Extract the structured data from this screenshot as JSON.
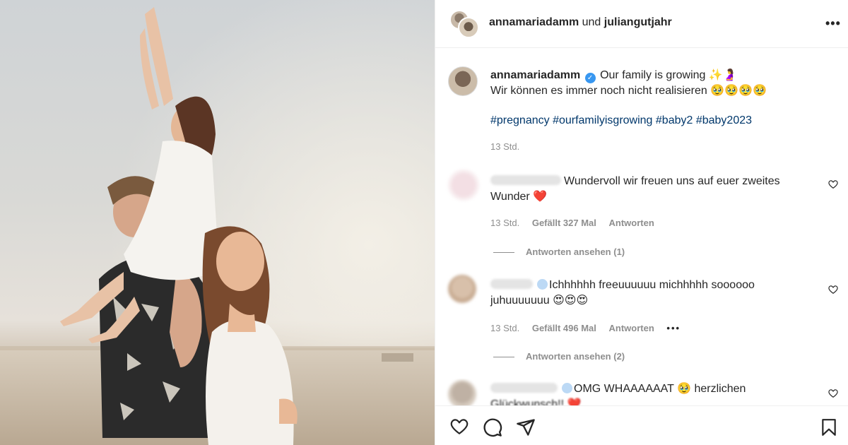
{
  "header": {
    "user1": "annamariadamm",
    "connector": "und",
    "user2": "juliangutjahr"
  },
  "caption": {
    "username": "annamariadamm",
    "verified_mark": "✓",
    "line1": "Our family is growing ✨🤰",
    "line2": "Wir können es immer noch nicht realisieren 🥹🥹🥹🥹",
    "hashtags": "#pregnancy #ourfamilyisgrowing #baby2 #baby2023",
    "time": "13 Std."
  },
  "comments": [
    {
      "text": "Wundervoll wir freuen uns auf euer zweites Wunder ❤️",
      "time": "13 Std.",
      "likes": "Gefällt 327 Mal",
      "reply": "Antworten",
      "view_replies": "Antworten ansehen (1)"
    },
    {
      "text": "Ichhhhhh freeuuuuuu michhhhh soooooo juhuuuuuuu 😍😍😍",
      "time": "13 Std.",
      "likes": "Gefällt 496 Mal",
      "reply": "Antworten",
      "more": "•••",
      "view_replies": "Antworten ansehen (2)"
    },
    {
      "text": "OMG WHAAAAAAT 🥹 herzlichen",
      "text2": "Glückwunsch!! ❤️"
    }
  ],
  "icons": {
    "more": "more-horizontal-icon",
    "like": "heart-icon",
    "comment": "comment-icon",
    "share": "send-icon",
    "save": "bookmark-icon"
  },
  "colors": {
    "hashtag": "#00376b",
    "verified": "#3897f0",
    "muted": "#8e8e8e"
  }
}
